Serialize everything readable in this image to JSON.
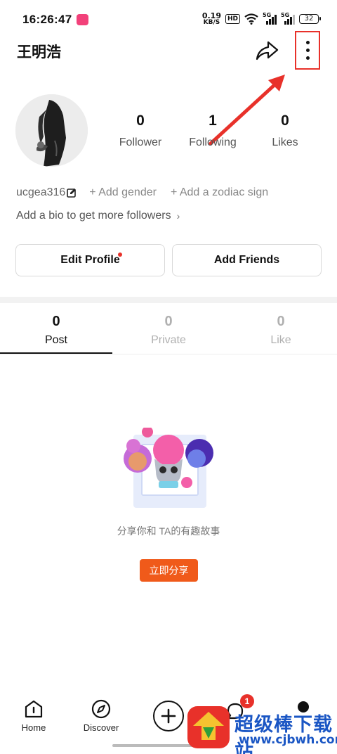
{
  "status_bar": {
    "time": "16:26:47",
    "net_speed_value": "0.19",
    "net_speed_unit": "KB/S",
    "hd_label": "HD",
    "signal1_label": "5G",
    "signal2_label": "5G",
    "battery": "32"
  },
  "header": {
    "username": "王明浩",
    "share_icon": "share-arrow-icon",
    "more_icon": "more-vertical-icon",
    "annotation_color": "#e8312a"
  },
  "profile": {
    "stats": [
      {
        "value": "0",
        "label": "Follower"
      },
      {
        "value": "1",
        "label": "Following"
      },
      {
        "value": "0",
        "label": "Likes"
      }
    ],
    "user_id": "ucgea316",
    "add_gender": "+ Add gender",
    "add_zodiac": "+ Add a zodiac sign",
    "bio_prompt": "Add a bio to get more followers",
    "bio_chevron": "›",
    "edit_profile_label": "Edit Profile",
    "add_friends_label": "Add Friends"
  },
  "tabs": [
    {
      "count": "0",
      "label": "Post",
      "active": true
    },
    {
      "count": "0",
      "label": "Private",
      "active": false
    },
    {
      "count": "0",
      "label": "Like",
      "active": false
    }
  ],
  "empty_state": {
    "message": "分享你和 TA的有趣故事",
    "button_label": "立即分享",
    "accent_color": "#f05a1a"
  },
  "bottom_nav": {
    "home_label": "Home",
    "discover_label": "Discover",
    "inbox_badge": "1"
  },
  "watermark": {
    "title": "超级棒下载站",
    "url": "www.cjbwh.com"
  }
}
